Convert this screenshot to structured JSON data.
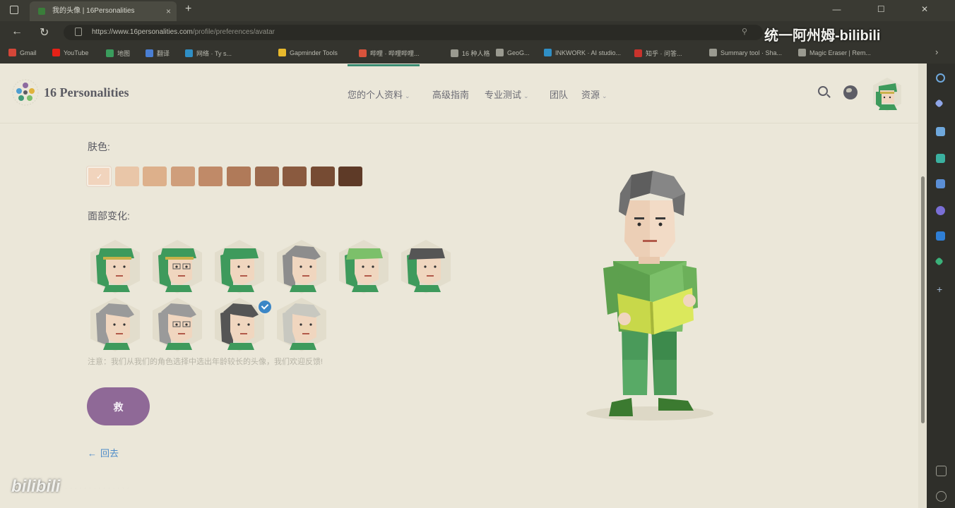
{
  "browser": {
    "tab_title": "我的头像 | 16Personalities",
    "tab_close": "×",
    "new_tab": "+",
    "window_controls": "— ☐ ✕",
    "url_host": "https://www.16personalities.com",
    "url_path": "/profile/preferences/avatar",
    "watermark_top": "统一阿州姆-bilibili",
    "bookmarks": [
      {
        "label": "Gmail",
        "color": "#d44638"
      },
      {
        "label": "YouTube",
        "color": "#e62117"
      },
      {
        "label": "地图",
        "color": "#3a9d5d"
      },
      {
        "label": "翻译",
        "color": "#4a7fd4"
      },
      {
        "label": "网络 · Ty s...",
        "color": "#2f8fc6"
      },
      {
        "label": "Gapminder Tools",
        "color": "#e8b92c"
      },
      {
        "label": "哔哩 · 哔哩哔哩...",
        "color": "#d8533c"
      },
      {
        "label": "16 种人格",
        "color": "#9a9a90"
      },
      {
        "label": "GeoG...",
        "color": "#9a9a90"
      },
      {
        "label": "INKWORK · AI studio...",
        "color": "#2f8fc6"
      },
      {
        "label": "知乎 · 问答...",
        "color": "#c9332c"
      },
      {
        "label": "Summary tool · Sha...",
        "color": "#9a9a90"
      },
      {
        "label": "Magic Eraser | Rem...",
        "color": "#9a9a90"
      }
    ]
  },
  "site": {
    "logo_text": "16 Personalities",
    "nav": [
      {
        "label": "您的个人资料",
        "has_caret": true
      },
      {
        "label": "高级指南",
        "has_caret": false
      },
      {
        "label": "专业测试",
        "has_caret": true
      },
      {
        "label": "团队",
        "has_caret": false
      },
      {
        "label": "资源",
        "has_caret": true
      }
    ],
    "caret_glyph": "⌄"
  },
  "avatar_editor": {
    "skin_label": "肤色:",
    "skin_tones": [
      "#f1d4bd",
      "#e9c6a8",
      "#ddb08b",
      "#cf9e7b",
      "#c08a68",
      "#b07a59",
      "#9c6a4d",
      "#8a5a3f",
      "#764b33",
      "#5e3a27"
    ],
    "selected_skin_index": 0,
    "check_glyph": "✓",
    "face_label": "面部变化:",
    "faces_selected_index": 8,
    "note": "注意：我们从我们的角色选择中选出年龄较长的头像，我们欢迎反馈!",
    "save_label": "救",
    "back_arrow": "←",
    "back_label": "回去"
  },
  "overlay": {
    "bili_bottom": "bilibili",
    "bili_bottom_trail": "·  ·  ·  ·  ·  ·  ·  ·  ·  ·  ·  ·  ·  ·"
  }
}
